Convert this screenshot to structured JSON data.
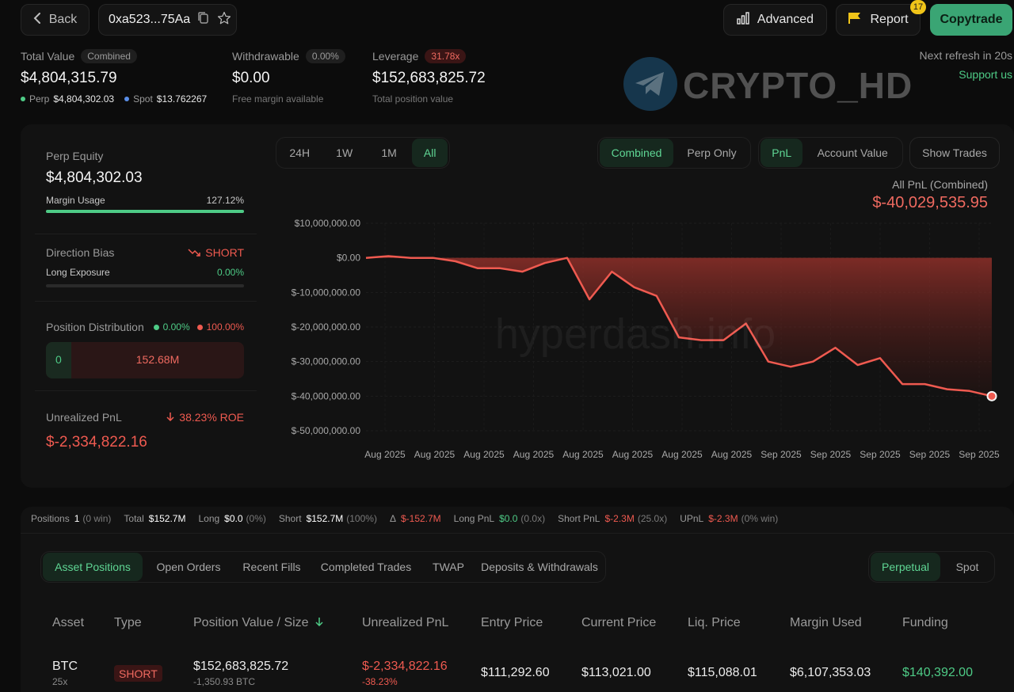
{
  "header": {
    "back_label": "Back",
    "address": "0xa523...75Aa",
    "advanced_label": "Advanced",
    "report_label": "Report",
    "report_badge": "17",
    "copytrade_label": "Copytrade"
  },
  "summary": {
    "total_value_label": "Total Value",
    "total_value_pill": "Combined",
    "total_value": "$4,804,315.79",
    "perp_label": "Perp",
    "perp_value": "$4,804,302.03",
    "spot_label": "Spot",
    "spot_value": "$13.762267",
    "withdrawable_label": "Withdrawable",
    "withdrawable_pill": "0.00%",
    "withdrawable_value": "$0.00",
    "withdrawable_sub": "Free margin available",
    "leverage_label": "Leverage",
    "leverage_pill": "31.78x",
    "leverage_value": "$152,683,825.72",
    "leverage_sub": "Total position value",
    "refresh_text": "Next refresh in 20s",
    "support_label": "Support us"
  },
  "watermark": {
    "brand_text": "CRYPTO_HD",
    "chart_text": "hyperdash.info"
  },
  "left_panel": {
    "perp_equity_label": "Perp Equity",
    "perp_equity_value": "$4,804,302.03",
    "margin_usage_label": "Margin Usage",
    "margin_usage_value": "127.12%",
    "margin_usage_fraction": 1.0,
    "direction_bias_label": "Direction Bias",
    "direction_bias_value": "SHORT",
    "long_exposure_label": "Long Exposure",
    "long_exposure_value": "0.00%",
    "position_distribution_label": "Position Distribution",
    "long_pct": "0.00%",
    "short_pct": "100.00%",
    "dist_long_value": "0",
    "dist_short_value": "152.68M",
    "unrealized_label": "Unrealized PnL",
    "roe_value": "38.23% ROE",
    "unrealized_value": "$-2,334,822.16"
  },
  "chart_controls": {
    "ranges": [
      "24H",
      "1W",
      "1M",
      "All"
    ],
    "active_range": "All",
    "modes": [
      "Combined",
      "Perp Only"
    ],
    "active_mode": "Combined",
    "metrics": [
      "PnL",
      "Account Value"
    ],
    "active_metric": "PnL",
    "show_trades_label": "Show Trades",
    "pnl_title": "All PnL (Combined)",
    "pnl_total": "$-40,029,535.95"
  },
  "colors": {
    "accent_green": "#4ecb86",
    "negative_red": "#ef5a50",
    "copytrade_bg": "#3aa574"
  },
  "chart_data": {
    "type": "area",
    "title": "All PnL (Combined)",
    "ylim": [
      -50000000,
      10000000
    ],
    "y_ticks": [
      "$10,000,000.00",
      "$0.00",
      "$-10,000,000.00",
      "$-20,000,000.00",
      "$-30,000,000.00",
      "$-40,000,000.00",
      "$-50,000,000.00"
    ],
    "y_tick_values": [
      10000000,
      0,
      -10000000,
      -20000000,
      -30000000,
      -40000000,
      -50000000
    ],
    "x_ticks": [
      "Aug 2025",
      "Aug 2025",
      "Aug 2025",
      "Aug 2025",
      "Aug 2025",
      "Aug 2025",
      "Aug 2025",
      "Aug 2025",
      "Sep 2025",
      "Sep 2025",
      "Sep 2025",
      "Sep 2025",
      "Sep 2025"
    ],
    "grid": true,
    "series": [
      {
        "values": [
          0,
          500000,
          0,
          0,
          -1000000,
          -3000000,
          -3000000,
          -4000000,
          -1500000,
          0,
          -12000000,
          -4000000,
          -8500000,
          -11000000,
          -23000000,
          -23800000,
          -23800000,
          -19000000,
          -30000000,
          -31500000,
          -30000000,
          -26000000,
          -31000000,
          -29000000,
          -36500000,
          -36500000,
          -38000000,
          -38500000,
          -40000000
        ]
      }
    ]
  },
  "positions_summary": [
    {
      "label": "Positions",
      "value": "1",
      "extra": "(0 win)",
      "color": "#ffffff"
    },
    {
      "label": "Total",
      "value": "$152.7M",
      "extra": "",
      "color": "#ffffff"
    },
    {
      "label": "Long",
      "value": "$0.0",
      "extra": "(0%)",
      "color": "#ffffff"
    },
    {
      "label": "Short",
      "value": "$152.7M",
      "extra": "(100%)",
      "color": "#ffffff"
    },
    {
      "label": "Δ",
      "value": "$-152.7M",
      "extra": "",
      "color": "#ef5a50"
    },
    {
      "label": "Long PnL",
      "value": "$0.0",
      "extra": "(0.0x)",
      "color": "#4ecb86"
    },
    {
      "label": "Short PnL",
      "value": "$-2.3M",
      "extra": "(25.0x)",
      "color": "#ef5a50"
    },
    {
      "label": "UPnL",
      "value": "$-2.3M",
      "extra": "(0% win)",
      "color": "#ef5a50"
    }
  ],
  "tabs": {
    "items": [
      "Asset Positions",
      "Open Orders",
      "Recent Fills",
      "Completed Trades",
      "TWAP",
      "Deposits & Withdrawals"
    ],
    "active": "Asset Positions",
    "market_types": [
      "Perpetual",
      "Spot"
    ],
    "active_market": "Perpetual"
  },
  "table": {
    "headers": [
      "Asset",
      "Type",
      "Position Value / Size",
      "Unrealized PnL",
      "Entry Price",
      "Current Price",
      "Liq. Price",
      "Margin Used",
      "Funding"
    ],
    "row": {
      "asset": "BTC",
      "leverage": "25x",
      "type": "SHORT",
      "position_value": "$152,683,825.72",
      "size": "-1,350.93 BTC",
      "unrealized_pnl": "$-2,334,822.16",
      "unrealized_pct": "-38.23%",
      "entry_price": "$111,292.60",
      "current_price": "$113,021.00",
      "liq_price": "$115,088.01",
      "margin_used": "$6,107,353.03",
      "funding": "$140,392.00"
    }
  }
}
